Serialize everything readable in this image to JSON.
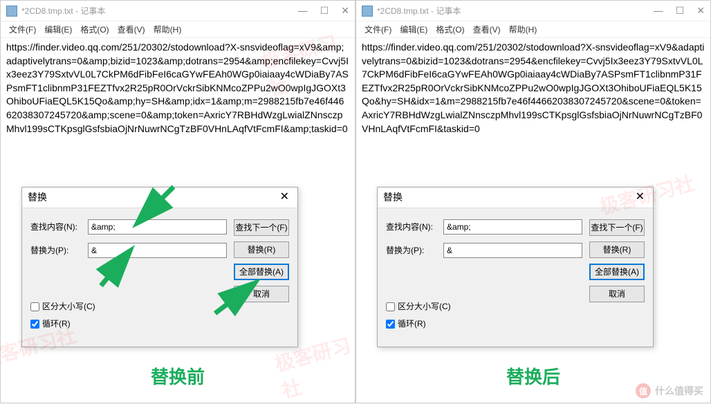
{
  "window": {
    "title": "*2CD8.tmp.txt - 记事本",
    "menus": {
      "file": "文件(F)",
      "edit": "编辑(E)",
      "format": "格式(O)",
      "view": "查看(V)",
      "help": "帮助(H)"
    }
  },
  "left": {
    "text": "https://finder.video.qq.com/251/20302/stodownload?X-snsvideoflag=xV9&amp;adaptivelytrans=0&amp;bizid=1023&amp;dotrans=2954&amp;encfilekey=Cvvj5Ix3eez3Y79SxtvVL0L7CkPM6dFibFeI6caGYwFEAh0WGp0iaiaay4cWDiaBy7ASPsmFT1clibnmP31FEZTfvx2R25pR0OrVckrSibKNMcoZPPu2wO0wpIgJGOXt3OhiboUFiaEQL5K15Qo&amp;hy=SH&amp;idx=1&amp;m=2988215fb7e46f44662038307245720&amp;scene=0&amp;token=AxricY7RBHdWzgLwialZNnsczpMhvl199sCTKpsglGsfsbiaOjNrNuwrNCgTzBF0VHnLAqfVtFcmFI&amp;taskid=0",
    "caption": "替换前"
  },
  "right": {
    "text": "https://finder.video.qq.com/251/20302/stodownload?X-snsvideoflag=xV9&adaptivelytrans=0&bizid=1023&dotrans=2954&encfilekey=Cvvj5Ix3eez3Y79SxtvVL0L7CkPM6dFibFeI6caGYwFEAh0WGp0iaiaay4cWDiaBy7ASPsmFT1clibnmP31FEZTfvx2R25pR0OrVckrSibKNMcoZPPu2wO0wpIgJGOXt3OhiboUFiaEQL5K15Qo&hy=SH&idx=1&m=2988215fb7e46f44662038307245720&scene=0&token=AxricY7RBHdWzgLwialZNnsczpMhvl199sCTKpsglGsfsbiaOjNrNuwrNCgTzBF0VHnLAqfVtFcmFI&taskid=0",
    "caption": "替换后"
  },
  "dialog": {
    "title": "替换",
    "find_label": "查找内容(N):",
    "replace_label": "替换为(P):",
    "find_value": "&amp;",
    "replace_value": "&",
    "btn_findnext": "查找下一个(F)",
    "btn_replace": "替换(R)",
    "btn_replaceall": "全部替换(A)",
    "btn_cancel": "取消",
    "chk_case": "区分大小写(C)",
    "chk_loop": "循环(R)"
  },
  "watermark": {
    "text": "极客研习社",
    "site": "什么值得买",
    "badge": "值"
  }
}
